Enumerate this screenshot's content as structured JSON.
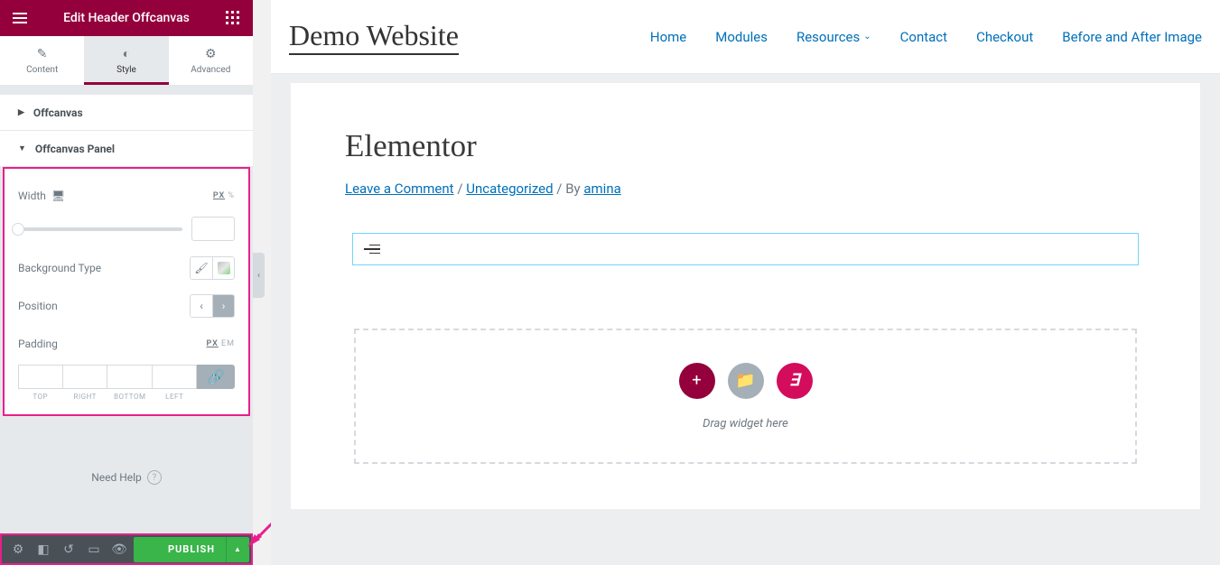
{
  "sidebar": {
    "title": "Edit Header Offcanvas",
    "tabs": {
      "content": "Content",
      "style": "Style",
      "advanced": "Advanced"
    },
    "sections": {
      "offcanvas": "Offcanvas",
      "offcanvas_panel": "Offcanvas Panel"
    },
    "controls": {
      "width_label": "Width",
      "width_units": {
        "px": "PX",
        "pct": "%"
      },
      "bg_type_label": "Background Type",
      "position_label": "Position",
      "padding_label": "Padding",
      "padding_units": {
        "px": "PX",
        "em": "EM"
      },
      "padding_sides": {
        "top": "TOP",
        "right": "RIGHT",
        "bottom": "BOTTOM",
        "left": "LEFT"
      }
    },
    "need_help": "Need Help"
  },
  "bottom_bar": {
    "publish": "PUBLISH"
  },
  "preview": {
    "site_title": "Demo Website",
    "nav": [
      "Home",
      "Modules",
      "Resources",
      "Contact",
      "Checkout",
      "Before and After Image"
    ],
    "heading": "Elementor",
    "meta": {
      "leave_comment": "Leave a Comment",
      "sep1": " / ",
      "category": "Uncategorized",
      "sep2": " / By ",
      "author": "amina"
    },
    "drop_text": "Drag widget here"
  }
}
